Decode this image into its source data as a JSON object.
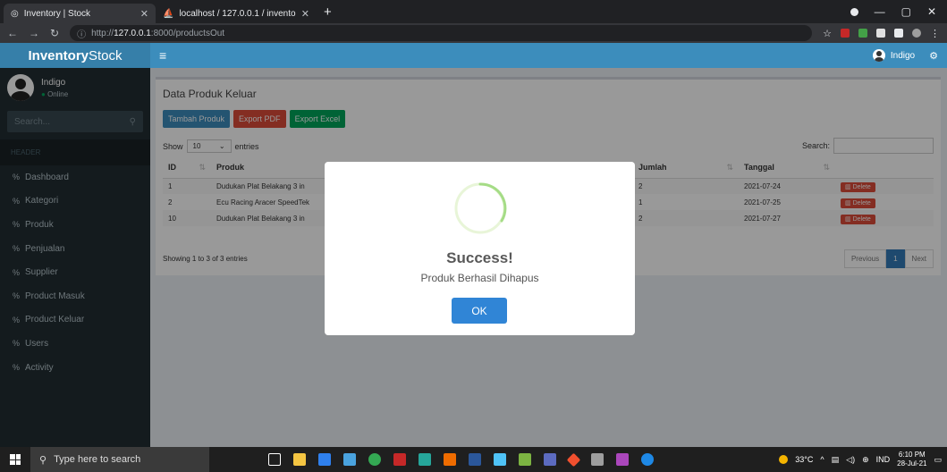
{
  "browser": {
    "tabs": [
      {
        "title": "Inventory | Stock",
        "active": true
      },
      {
        "title": "localhost / 127.0.0.1 / inventory",
        "active": false
      }
    ],
    "url_prefix": "http://",
    "url_host": "127.0.0.1",
    "url_rest": ":8000/productsOut"
  },
  "app": {
    "logo_bold": "Inventory",
    "logo_rest": "Stock",
    "nav_user": "Indigo"
  },
  "sidebar": {
    "user_name": "Indigo",
    "user_status": "Online",
    "search_placeholder": "Search...",
    "header": "HEADER",
    "items": [
      {
        "label": "Dashboard"
      },
      {
        "label": "Kategori"
      },
      {
        "label": "Produk"
      },
      {
        "label": "Penjualan"
      },
      {
        "label": "Supplier"
      },
      {
        "label": "Product Masuk"
      },
      {
        "label": "Product Keluar"
      },
      {
        "label": "Users"
      },
      {
        "label": "Activity"
      }
    ]
  },
  "main": {
    "title": "Data Produk Keluar",
    "buttons": {
      "add": "Tambah Produk",
      "pdf": "Export PDF",
      "excel": "Export Excel"
    },
    "show_label": "Show",
    "entries_value": "10",
    "entries_label": "entries",
    "search_label": "Search:",
    "columns": [
      "ID",
      "Produk",
      "Jumlah",
      "Tanggal"
    ],
    "rows": [
      {
        "id": "1",
        "produk": "Dudukan Plat Belakang 3 in",
        "jumlah": "2",
        "tanggal": "2021-07-24",
        "action": "Delete"
      },
      {
        "id": "2",
        "produk": "Ecu Racing Aracer SpeedTek",
        "jumlah": "1",
        "tanggal": "2021-07-25",
        "action": "Delete"
      },
      {
        "id": "10",
        "produk": "Dudukan Plat Belakang 3 in",
        "jumlah": "2",
        "tanggal": "2021-07-27",
        "action": "Delete"
      }
    ],
    "info": "Showing 1 to 3 of 3 entries",
    "pager": {
      "prev": "Previous",
      "current": "1",
      "next": "Next"
    }
  },
  "modal": {
    "title": "Success!",
    "text": "Produk Berhasil Dihapus",
    "ok": "OK"
  },
  "taskbar": {
    "search_placeholder": "Type here to search",
    "weather": "33°C",
    "lang": "IND",
    "time": "6:10 PM",
    "date": "28-Jul-21"
  },
  "colors": {
    "primary": "#3c8dbc",
    "danger": "#dd4b39",
    "success": "#00a65a",
    "sidebar": "#222d32",
    "modal_ok": "#3085d6"
  }
}
